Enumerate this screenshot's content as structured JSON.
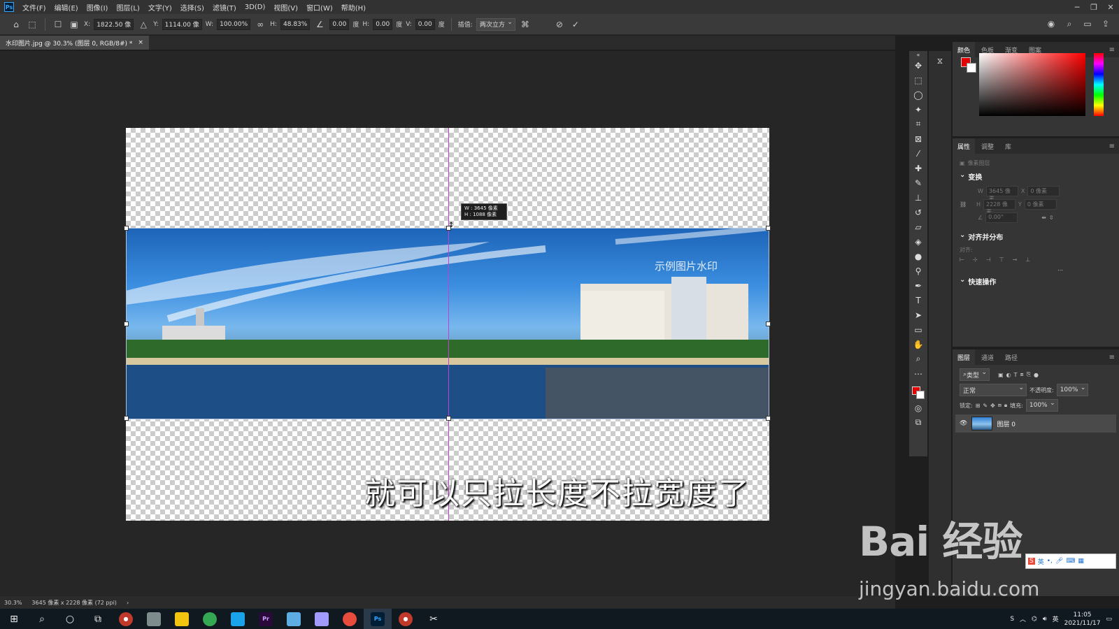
{
  "menubar": {
    "logo": "Ps",
    "items": [
      "文件(F)",
      "编辑(E)",
      "图像(I)",
      "图层(L)",
      "文字(Y)",
      "选择(S)",
      "滤镜(T)",
      "3D(D)",
      "视图(V)",
      "窗口(W)",
      "帮助(H)"
    ]
  },
  "options": {
    "x_label": "X:",
    "x_value": "1822.50 像",
    "y_label": "Y:",
    "y_value": "1114.00 像",
    "w_label": "W:",
    "w_value": "100.00%",
    "h_label": "H:",
    "h_value": "48.83%",
    "angle_value": "0.00",
    "angle_unit": "度",
    "hskew_label": "H:",
    "hskew_value": "0.00",
    "hskew_unit": "度",
    "vskew_label": "V:",
    "vskew_value": "0.00",
    "vskew_unit": "度",
    "interp_label": "插值:",
    "interp_value": "两次立方"
  },
  "document": {
    "tab_title": "水印图片.jpg @ 30.3% (图层 0, RGB/8#) *",
    "close": "×"
  },
  "canvas": {
    "tooltip_w": "W : 3645 像素",
    "tooltip_h": "H : 1088 像素",
    "watermark_text": "示例图片水印",
    "subtitle": "就可以只拉长度不拉宽度了"
  },
  "color_panel": {
    "tabs": [
      "颜色",
      "色板",
      "渐变",
      "图案"
    ],
    "fg_color": "#e60000",
    "bg_color": "#ffffff"
  },
  "properties_panel": {
    "tabs": [
      "属性",
      "调整",
      "库"
    ],
    "layer_type": "像素图层",
    "transform_title": "变换",
    "w_label": "W",
    "w_value": "3645 像素",
    "x_label": "X",
    "x_value": "0 像素",
    "h_label": "H",
    "h_value": "2228 像素",
    "y_label": "Y",
    "y_value": "0 像素",
    "angle_value": "0.00°",
    "align_title": "对齐并分布",
    "align_label": "对齐:",
    "more": "...",
    "quick_title": "快速操作"
  },
  "layers_panel": {
    "tabs": [
      "图层",
      "通道",
      "路径"
    ],
    "filter_label": "类型",
    "blend_mode": "正常",
    "opacity_label": "不透明度:",
    "opacity_value": "100%",
    "lock_label": "锁定:",
    "fill_label": "填充:",
    "fill_value": "100%",
    "layer_name": "图层 0"
  },
  "status": {
    "zoom": "30.3%",
    "doc_info": "3645 像素 x 2228 像素 (72 ppi)"
  },
  "taskbar": {
    "time": "11:05",
    "date": "2021/11/17"
  },
  "watermark": {
    "brand": "Bai 经验",
    "url": "jingyan.baidu.com"
  }
}
